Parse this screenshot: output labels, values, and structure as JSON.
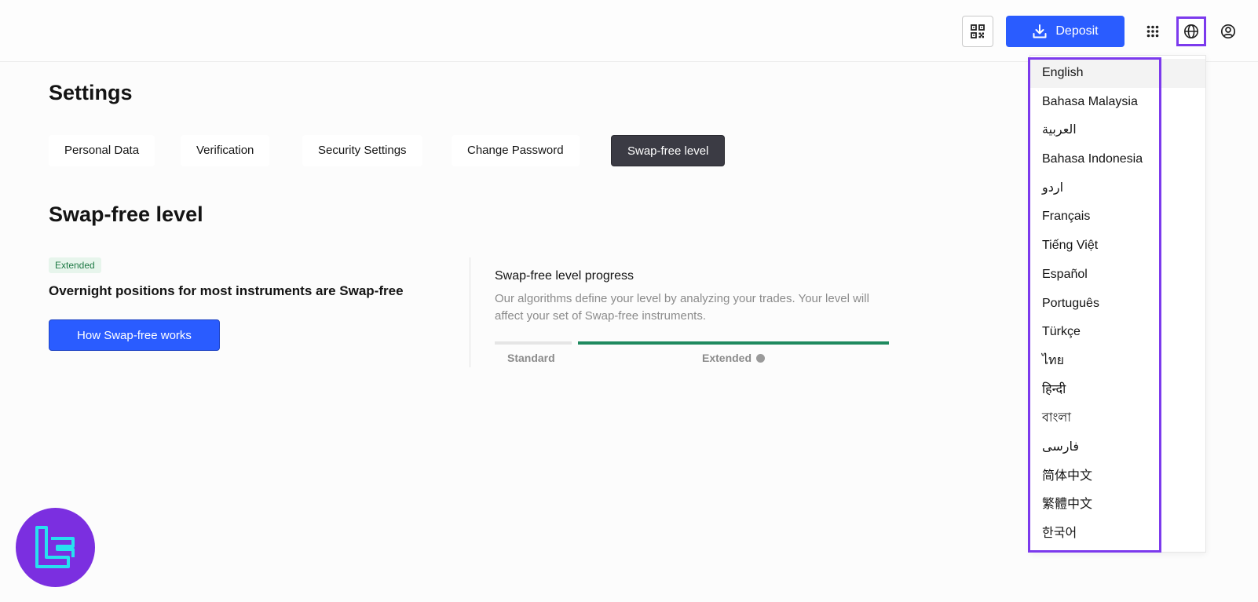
{
  "header": {
    "qr_icon": "qr-code-icon",
    "deposit_label": "Deposit",
    "deposit_icon": "download-icon",
    "apps_icon": "grid-icon",
    "globe_icon": "globe-icon",
    "user_icon": "user-circle-icon"
  },
  "page": {
    "title": "Settings"
  },
  "tabs": [
    {
      "label": "Personal Data",
      "active": false
    },
    {
      "label": "Verification",
      "active": false
    },
    {
      "label": "Security Settings",
      "active": false
    },
    {
      "label": "Change Password",
      "active": false
    },
    {
      "label": "Swap-free level",
      "active": true
    }
  ],
  "swap": {
    "title": "Swap-free level",
    "badge": "Extended",
    "description": "Overnight positions for most instruments are Swap-free",
    "button_label": "How Swap-free works"
  },
  "progress": {
    "title": "Swap-free level progress",
    "description": "Our algorithms define your level by analyzing your trades. Your level will affect your set of Swap-free instruments.",
    "levels": [
      {
        "label": "Standard"
      },
      {
        "label": "Extended"
      }
    ],
    "current_level": "Extended"
  },
  "languages": {
    "selected": "English",
    "items": [
      "English",
      "Bahasa Malaysia",
      "العربية",
      "Bahasa Indonesia",
      "اردو",
      "Français",
      "Tiếng Việt",
      "Español",
      "Português",
      "Türkçe",
      "ไทย",
      "हिन्दी",
      "বাংলা",
      "فارسی",
      "简体中文",
      "繁體中文",
      "한국어"
    ]
  },
  "colors": {
    "accent": "#2a5cff",
    "active_tab": "#3b3b44",
    "progress_green": "#1f8a5f",
    "highlight": "#7c3aed",
    "logo_bg": "#7b2fe0"
  }
}
